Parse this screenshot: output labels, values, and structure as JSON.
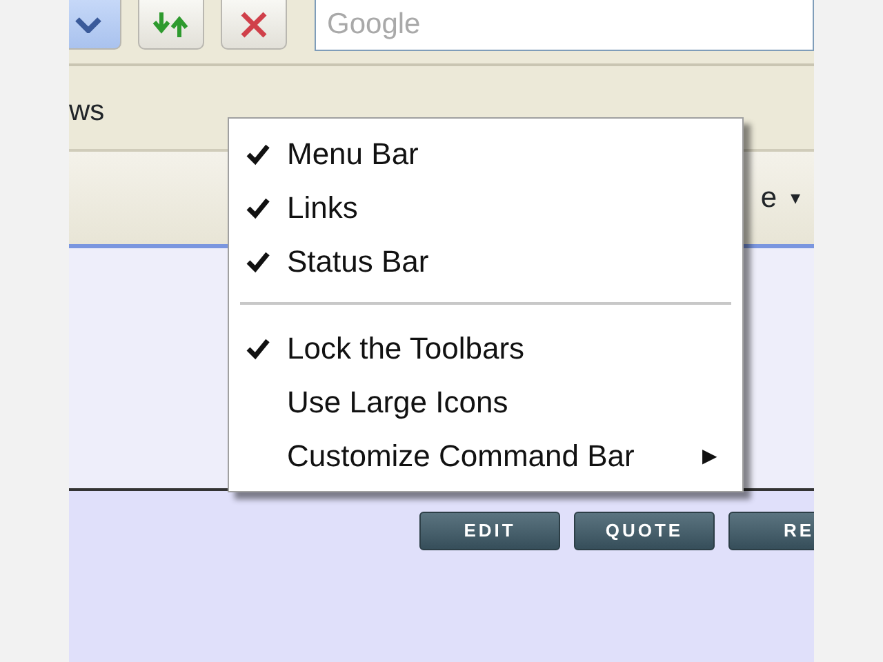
{
  "toolbar": {
    "search": {
      "placeholder": "Google"
    }
  },
  "links_bar": {
    "label": "ws"
  },
  "command_bar": {
    "label": "e",
    "caret": "▾"
  },
  "context_menu": {
    "items": [
      {
        "kind": "item",
        "label": "Menu Bar",
        "checked": true
      },
      {
        "kind": "item",
        "label": "Links",
        "checked": true
      },
      {
        "kind": "item",
        "label": "Status Bar",
        "checked": true
      },
      {
        "kind": "separator"
      },
      {
        "kind": "item",
        "label": "Lock the Toolbars",
        "checked": true
      },
      {
        "kind": "item",
        "label": "Use Large Icons",
        "checked": false
      },
      {
        "kind": "submenu",
        "label": "Customize Command Bar",
        "checked": false,
        "arrow": "▶"
      }
    ]
  },
  "post_buttons": [
    "EDIT",
    "QUOTE",
    "RE"
  ]
}
